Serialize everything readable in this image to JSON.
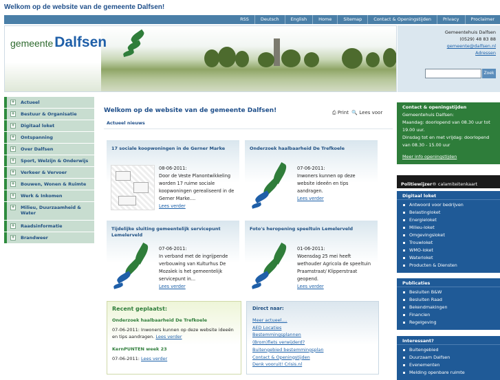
{
  "site_title": "Welkom op de website van de gemeente Dalfsen!",
  "topbar": [
    "RSS",
    "Deutsch",
    "English",
    "Home",
    "Sitemap",
    "Contact & Openingstijden",
    "Privacy",
    "Proclaimer"
  ],
  "logo": {
    "word1": "gemeente",
    "word2": "Dalfsen"
  },
  "contact": {
    "name": "Gemeentehuis Dalfsen",
    "phone": "(0529) 48 83 88",
    "email": "gemeente@dalfsen.nl",
    "addresses": "Adressen"
  },
  "search": {
    "button": "Zoek",
    "placeholder": ""
  },
  "leftnav": [
    "Actueel",
    "Bestuur & Organisatie",
    "Digitaal loket",
    "Ontspanning",
    "Over Dalfsen",
    "Sport, Welzijn & Onderwijs",
    "Verkeer & Vervoer",
    "Bouwen, Wonen & Ruimte",
    "Werk & Inkomen",
    "Milieu, Duurzaamheid & Water",
    "Raadsinformatie",
    "Brandweer"
  ],
  "main": {
    "title": "Welkom op de website van de gemeente Dalfsen!",
    "print": "Print",
    "read": "Lees voor",
    "news_head": "Actueel nieuws"
  },
  "news": [
    {
      "title": "17 sociale koopwoningen in de Gerner Marke",
      "date": "08-06-2011:",
      "text": "Door de Veste Planontwikkeling worden 17 ruime sociale koopwoningen gerealiseerd in de Gerner Marke....",
      "more": "Lees verder"
    },
    {
      "title": "Onderzoek haalbaarheid De Trefkoele",
      "date": "07-06-2011:",
      "text": "Inwoners kunnen op deze website ideeën en tips aandragen.",
      "more": "Lees verder"
    },
    {
      "title": "Tijdelijke sluiting gemeentelijk servicepunt Lemelerveld",
      "date": "07-06-2011:",
      "text": "In verband met de ingrijpende verbouwing van Kulturhus De Mozaïek is het gemeentelijk servicepunt in...",
      "more": "Lees verder"
    },
    {
      "title": "Foto's heropening speeltuin Lemelerveld",
      "date": "01-06-2011:",
      "text": "Woensdag 25 mei heeft wethouder Agricola de speeltuin Praamstraat/ Klipperstraat geopend.",
      "more": "Lees verder"
    }
  ],
  "recent": {
    "title": "Recent geplaatst:",
    "items": [
      {
        "title": "Onderzoek haalbaarheid De Trefkoele",
        "text": "07-06-2011: Inwoners kunnen op deze website ideeën en tips aandragen.",
        "more": "Lees verder"
      },
      {
        "title": "KernPUNTEN week 23",
        "text": "07-06-2011:",
        "more": "Lees verder"
      }
    ]
  },
  "direct": {
    "title": "Direct naar:",
    "links": [
      "Meer actueel....",
      "AED Locaties",
      "Bestemmingsplannen",
      "(Brom)fiets verwijderd?",
      "Buitengebied bestemmingsplan",
      "Contact & Openingstijden",
      "Denk vooruit! Crisis.nl"
    ]
  },
  "openingstijden": {
    "title": "Contact & openingstijden",
    "lines": [
      "Gemeentehuis Dalfsen:",
      "Maandag: doorlopend van 08.30 uur tot 19.00 uur.",
      "Dinsdag tot en met vrijdag: doorlopend van 08.30 - 15.00 uur"
    ],
    "more": "Meer info openingstijden"
  },
  "politiewijzer": {
    "brand": "Politiewijzer",
    "text": "calamiteitenkaart"
  },
  "digitaal": {
    "title": "Digitaal loket",
    "items": [
      "Antwoord voor bedrijven",
      "Belastingloket",
      "Energieloket",
      "Milieu-loket",
      "Omgevingsloket",
      "Trouwloket",
      "WMO-loket",
      "Waterloket",
      "Producten & Diensten"
    ]
  },
  "publicaties": {
    "title": "Publicaties",
    "items": [
      "Besluiten B&W",
      "Besluiten Raad",
      "Bekendmakingen",
      "Financien",
      "Regelgeving"
    ]
  },
  "interessant": {
    "title": "Interessant?",
    "items": [
      "Buitengebied",
      "Duurzaam Dalfsen",
      "Evenementen",
      "Melding openbare ruimte"
    ]
  },
  "colors": {
    "green": "#2e7d3a",
    "blue": "#1f5a97",
    "topbar": "#4a7fa8"
  }
}
